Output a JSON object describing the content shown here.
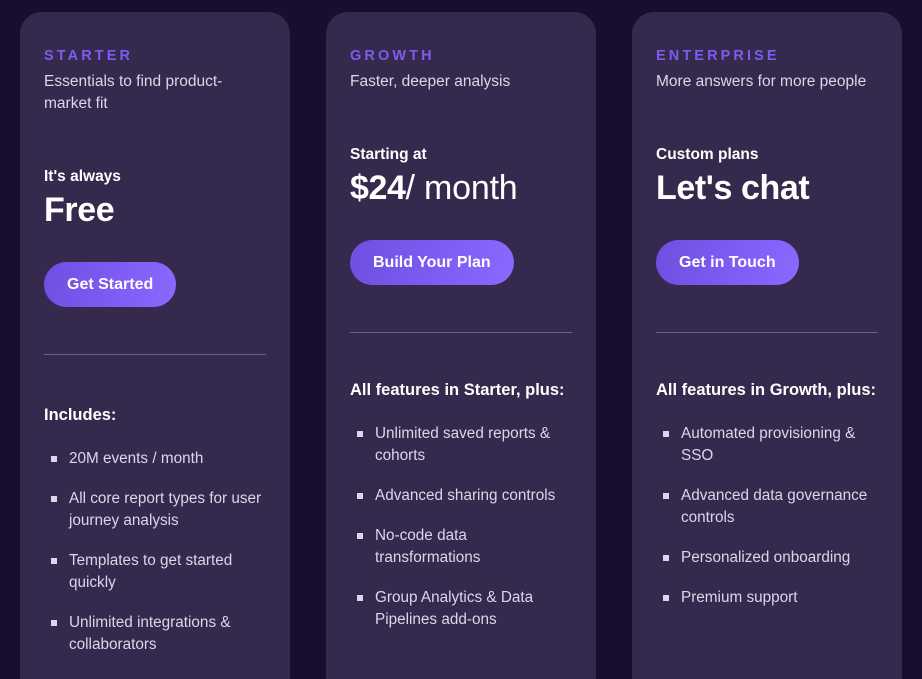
{
  "theme": {
    "page_background": "#180f2e",
    "card_background": "#352a4d",
    "accent": "#7c5cf0",
    "button_gradient_start": "#6f4fe0",
    "button_gradient_end": "#8a69ff",
    "text_primary": "#ffffff",
    "text_secondary": "#ddd6e8",
    "divider": "#6d6088"
  },
  "plans": [
    {
      "eyebrow": "STARTER",
      "tagline": "Essentials to find product-market fit",
      "price_caption": "It's always",
      "price_amount": "Free",
      "price_period": "",
      "cta_label": "Get Started",
      "features_heading": "Includes:",
      "features": [
        "20M events / month",
        "All core report types for user journey analysis",
        "Templates to get started quickly",
        "Unlimited integrations & collaborators"
      ]
    },
    {
      "eyebrow": "GROWTH",
      "tagline": "Faster, deeper analysis",
      "price_caption": "Starting at",
      "price_amount": "$24",
      "price_period": "/ month",
      "cta_label": "Build Your Plan",
      "features_heading": "All features in Starter, plus:",
      "features": [
        "Unlimited saved reports & cohorts",
        "Advanced sharing controls",
        "No-code data transformations",
        "Group Analytics & Data Pipelines add-ons"
      ]
    },
    {
      "eyebrow": "ENTERPRISE",
      "tagline": "More answers for more people",
      "price_caption": "Custom plans",
      "price_amount": "Let's chat",
      "price_period": "",
      "cta_label": "Get in Touch",
      "features_heading": "All features in Growth, plus:",
      "features": [
        "Automated provisioning & SSO",
        "Advanced data governance controls",
        "Personalized onboarding",
        "Premium support"
      ]
    }
  ]
}
